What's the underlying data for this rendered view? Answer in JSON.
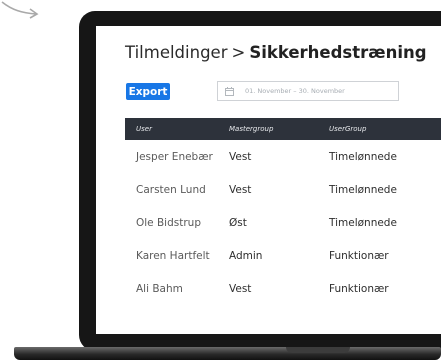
{
  "header": {
    "breadcrumb_parent": "Tilmeldinger",
    "separator": ">",
    "breadcrumb_current": "Sikkerhedstræning"
  },
  "toolbar": {
    "export_label": "Export",
    "date_range_placeholder": "01. November – 30. November"
  },
  "table": {
    "columns": [
      "User",
      "Mastergroup",
      "UserGroup"
    ],
    "rows": [
      [
        "Jesper Enebær",
        "Vest",
        "Timelønnede"
      ],
      [
        "Carsten Lund",
        "Vest",
        "Timelønnede"
      ],
      [
        "Ole Bidstrup",
        "Øst",
        "Timelønnede"
      ],
      [
        "Karen Hartfelt",
        "Admin",
        "Funktionær"
      ],
      [
        "Ali Bahm",
        "Vest",
        "Funktionær"
      ]
    ]
  },
  "colors": {
    "accent": "#1877e6",
    "table_header": "#2d323b",
    "laptop_bezel": "#161616"
  },
  "icons": {
    "date_range": "calendar-icon",
    "decoration": "curved-arrow-icon"
  }
}
